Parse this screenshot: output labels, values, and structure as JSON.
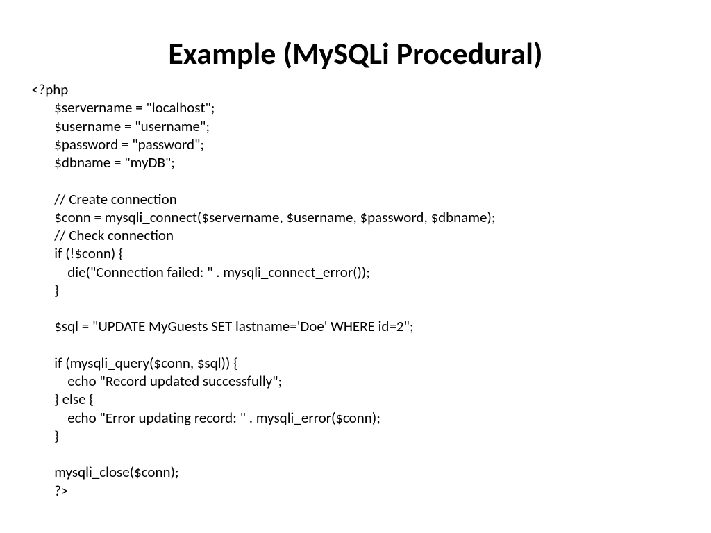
{
  "slide": {
    "title": "Example (MySQLi Procedural)",
    "code": "<?php\n       $servername = \"localhost\";\n       $username = \"username\";\n       $password = \"password\";\n       $dbname = \"myDB\";\n\n       // Create connection\n       $conn = mysqli_connect($servername, $username, $password, $dbname);\n       // Check connection\n       if (!$conn) {\n           die(\"Connection failed: \" . mysqli_connect_error());\n       }\n\n       $sql = \"UPDATE MyGuests SET lastname='Doe' WHERE id=2\";\n\n       if (mysqli_query($conn, $sql)) {\n           echo \"Record updated successfully\";\n       } else {\n           echo \"Error updating record: \" . mysqli_error($conn);\n       }\n\n       mysqli_close($conn);\n       ?>"
  }
}
